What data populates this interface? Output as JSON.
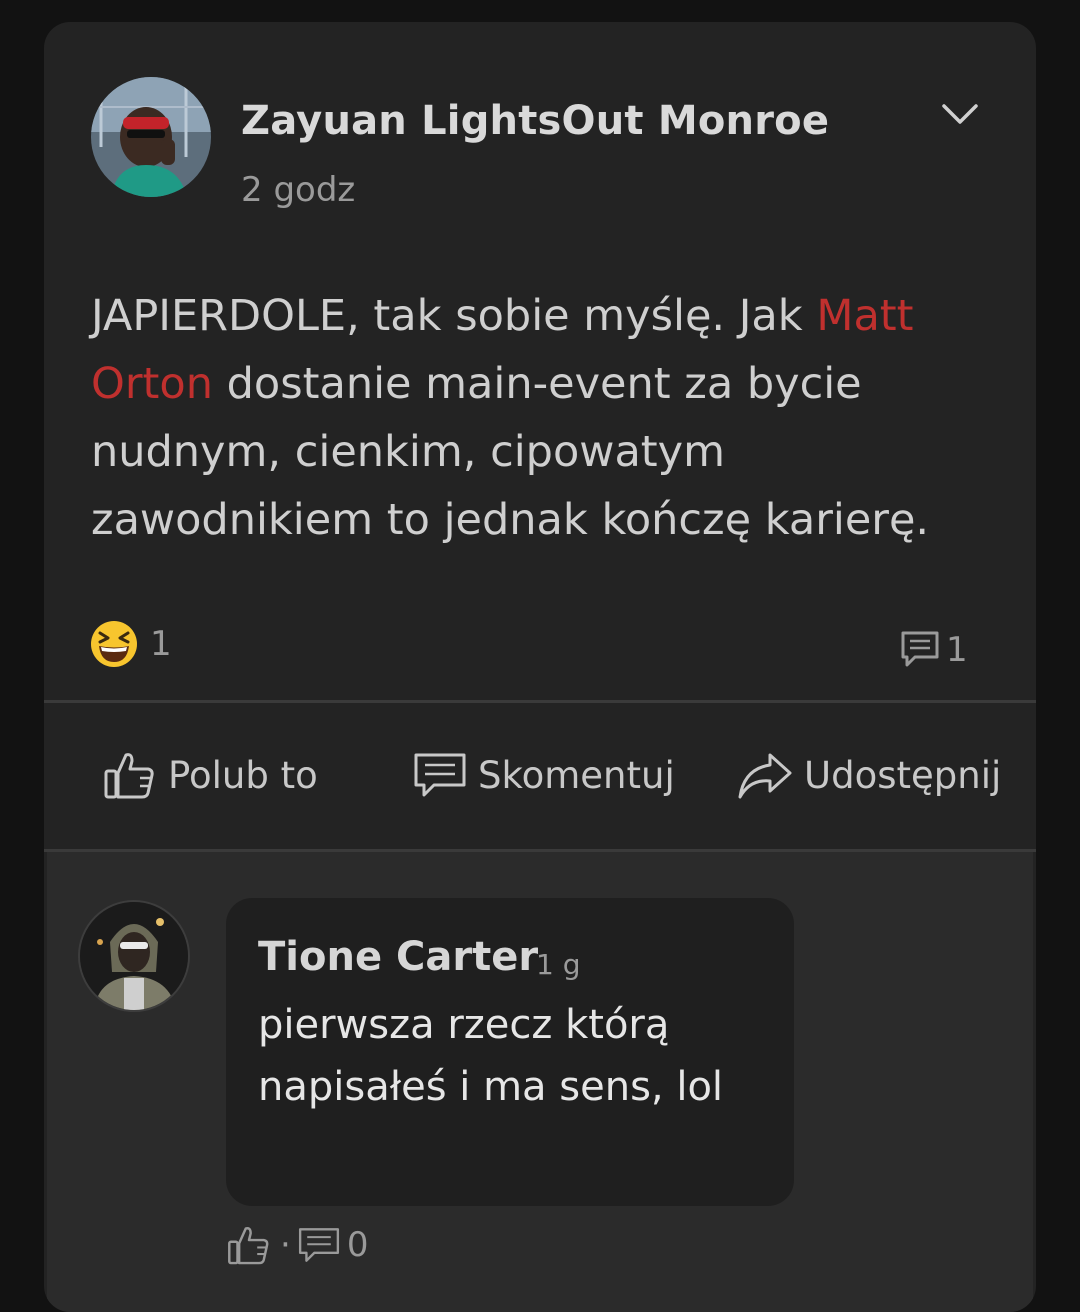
{
  "post": {
    "author": "Zayuan LightsOut Monroe",
    "time": "2 godz",
    "text_before": "JAPIERDOLE, tak sobie myślę. Jak ",
    "mention": "Matt Orton",
    "text_after": " dostanie main-event za bycie nudnym, cienkim, cipowatym zawodnikiem to jednak kończę karierę.",
    "reaction_count": "1",
    "comment_count": "1",
    "reaction_icon": "laughing-emoji-icon",
    "mention_color": "#c0302e"
  },
  "actions": {
    "like_label": "Polub to",
    "comment_label": "Skomentuj",
    "share_label": "Udostępnij"
  },
  "comment": {
    "author": "Tione Carter",
    "time": "1 g",
    "text": "pierwsza rzecz którą napisałeś i ma sens, lol",
    "separator": "·",
    "reply_count": "0"
  }
}
